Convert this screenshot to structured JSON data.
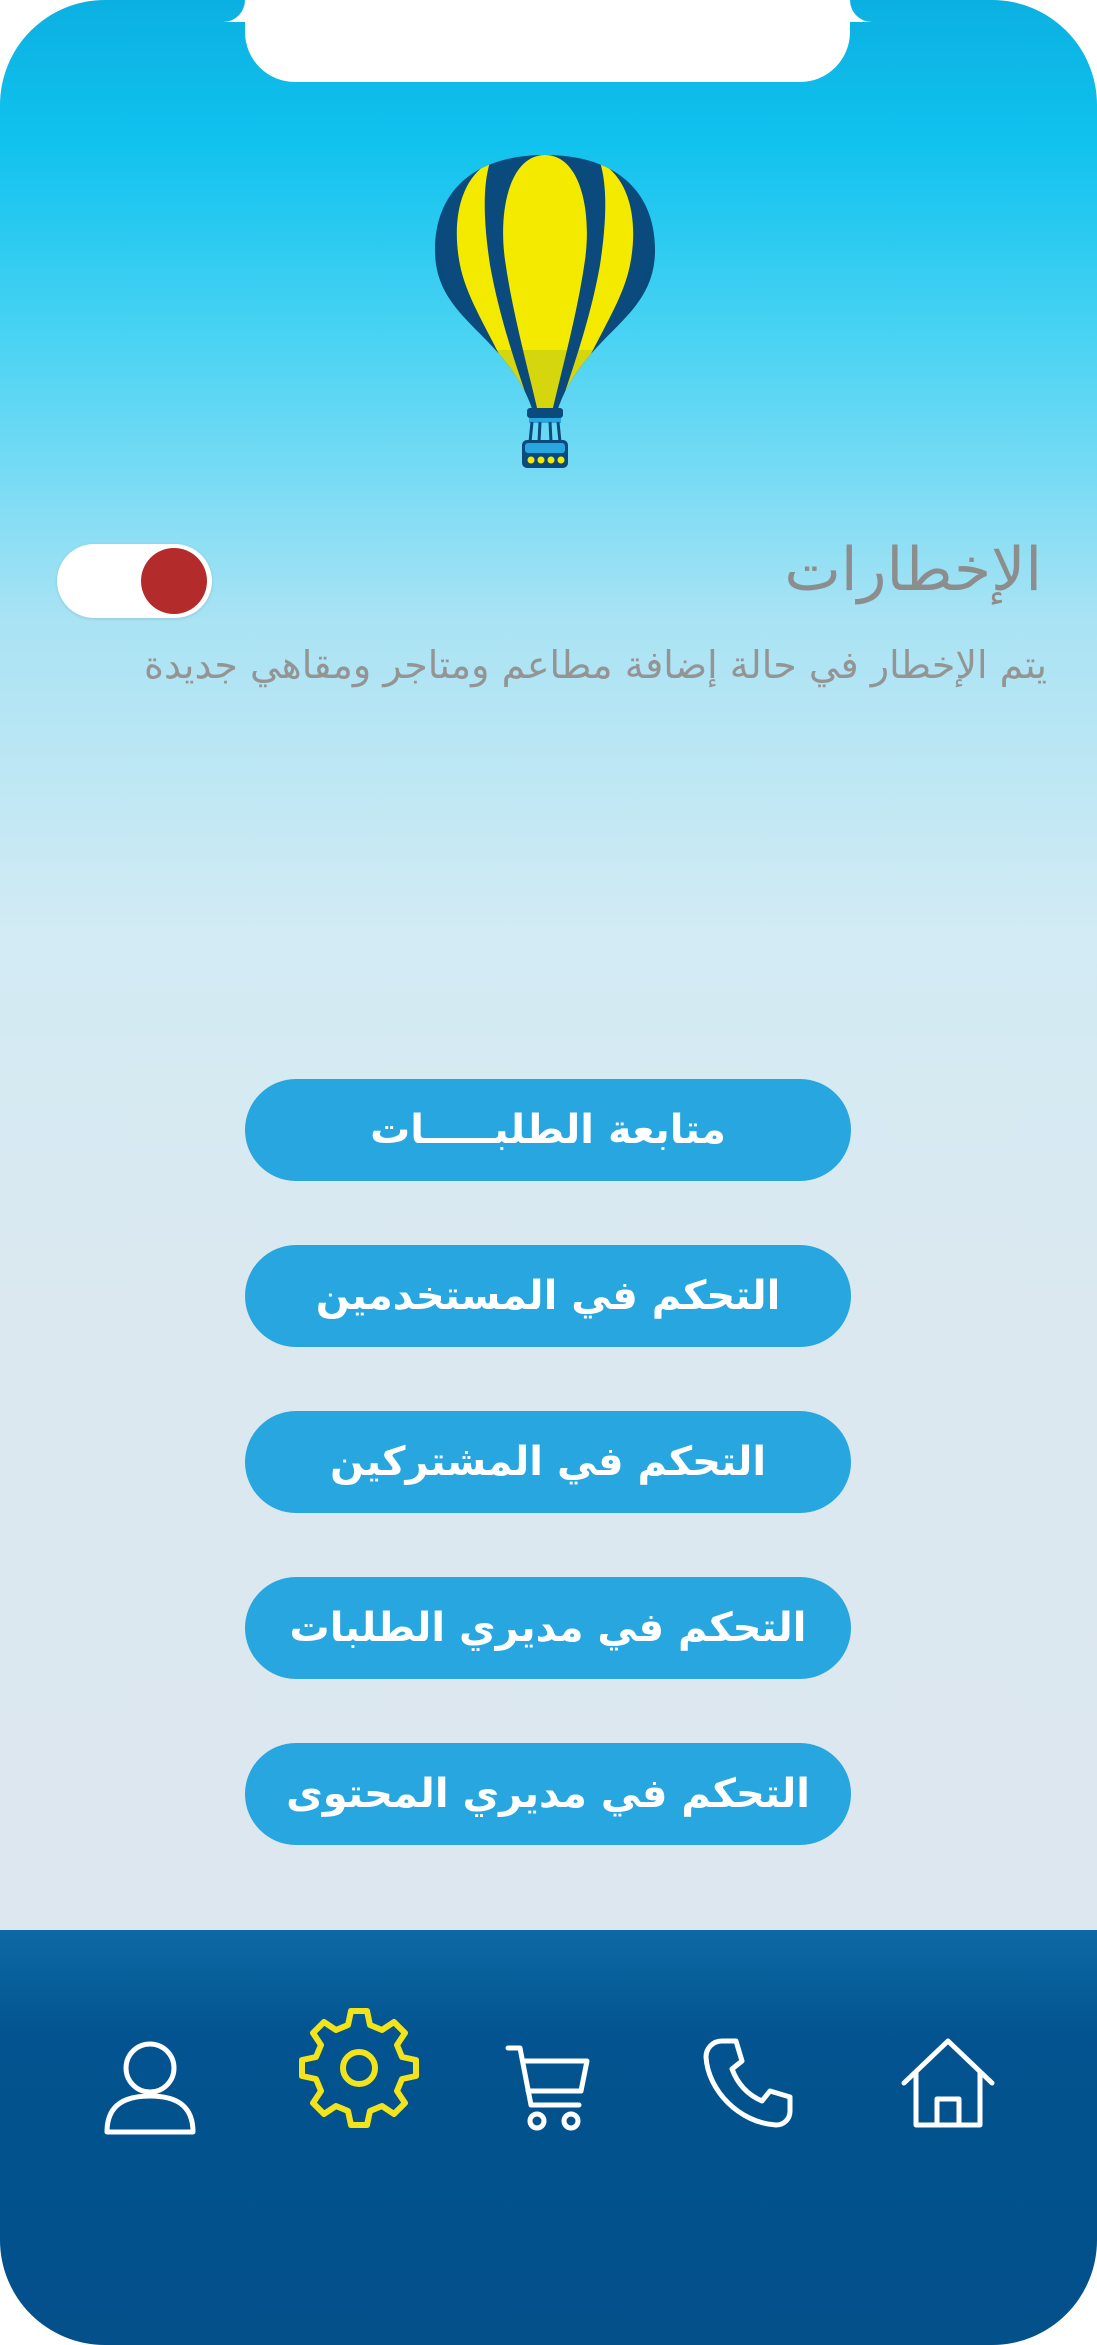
{
  "notifications": {
    "title": "الإخطارات",
    "description": "يتم الإخطار في حالة إضافة مطاعم ومتاجر ومقاهي جديدة",
    "toggle_on": true,
    "toggle_color": "#b42b2b"
  },
  "menu": {
    "items": [
      {
        "label": "متابعة الطلبـــــات"
      },
      {
        "label": "التحكم في المستخدمين"
      },
      {
        "label": "التحكم في المشتركين"
      },
      {
        "label": "التحكم في مديري الطلبات"
      },
      {
        "label": "التحكم في مديري المحتوى"
      }
    ],
    "button_color": "#27a6df"
  },
  "tabbar": {
    "items": [
      {
        "icon": "user-icon",
        "active": false
      },
      {
        "icon": "gear-icon",
        "active": true
      },
      {
        "icon": "cart-icon",
        "active": false
      },
      {
        "icon": "phone-icon",
        "active": false
      },
      {
        "icon": "home-icon",
        "active": false
      }
    ],
    "active_color": "#f2e31b",
    "background": "#02538f"
  },
  "logo": {
    "icon": "hot-air-balloon-icon",
    "colors": [
      "#f3ea00",
      "#0b4a7c"
    ]
  }
}
